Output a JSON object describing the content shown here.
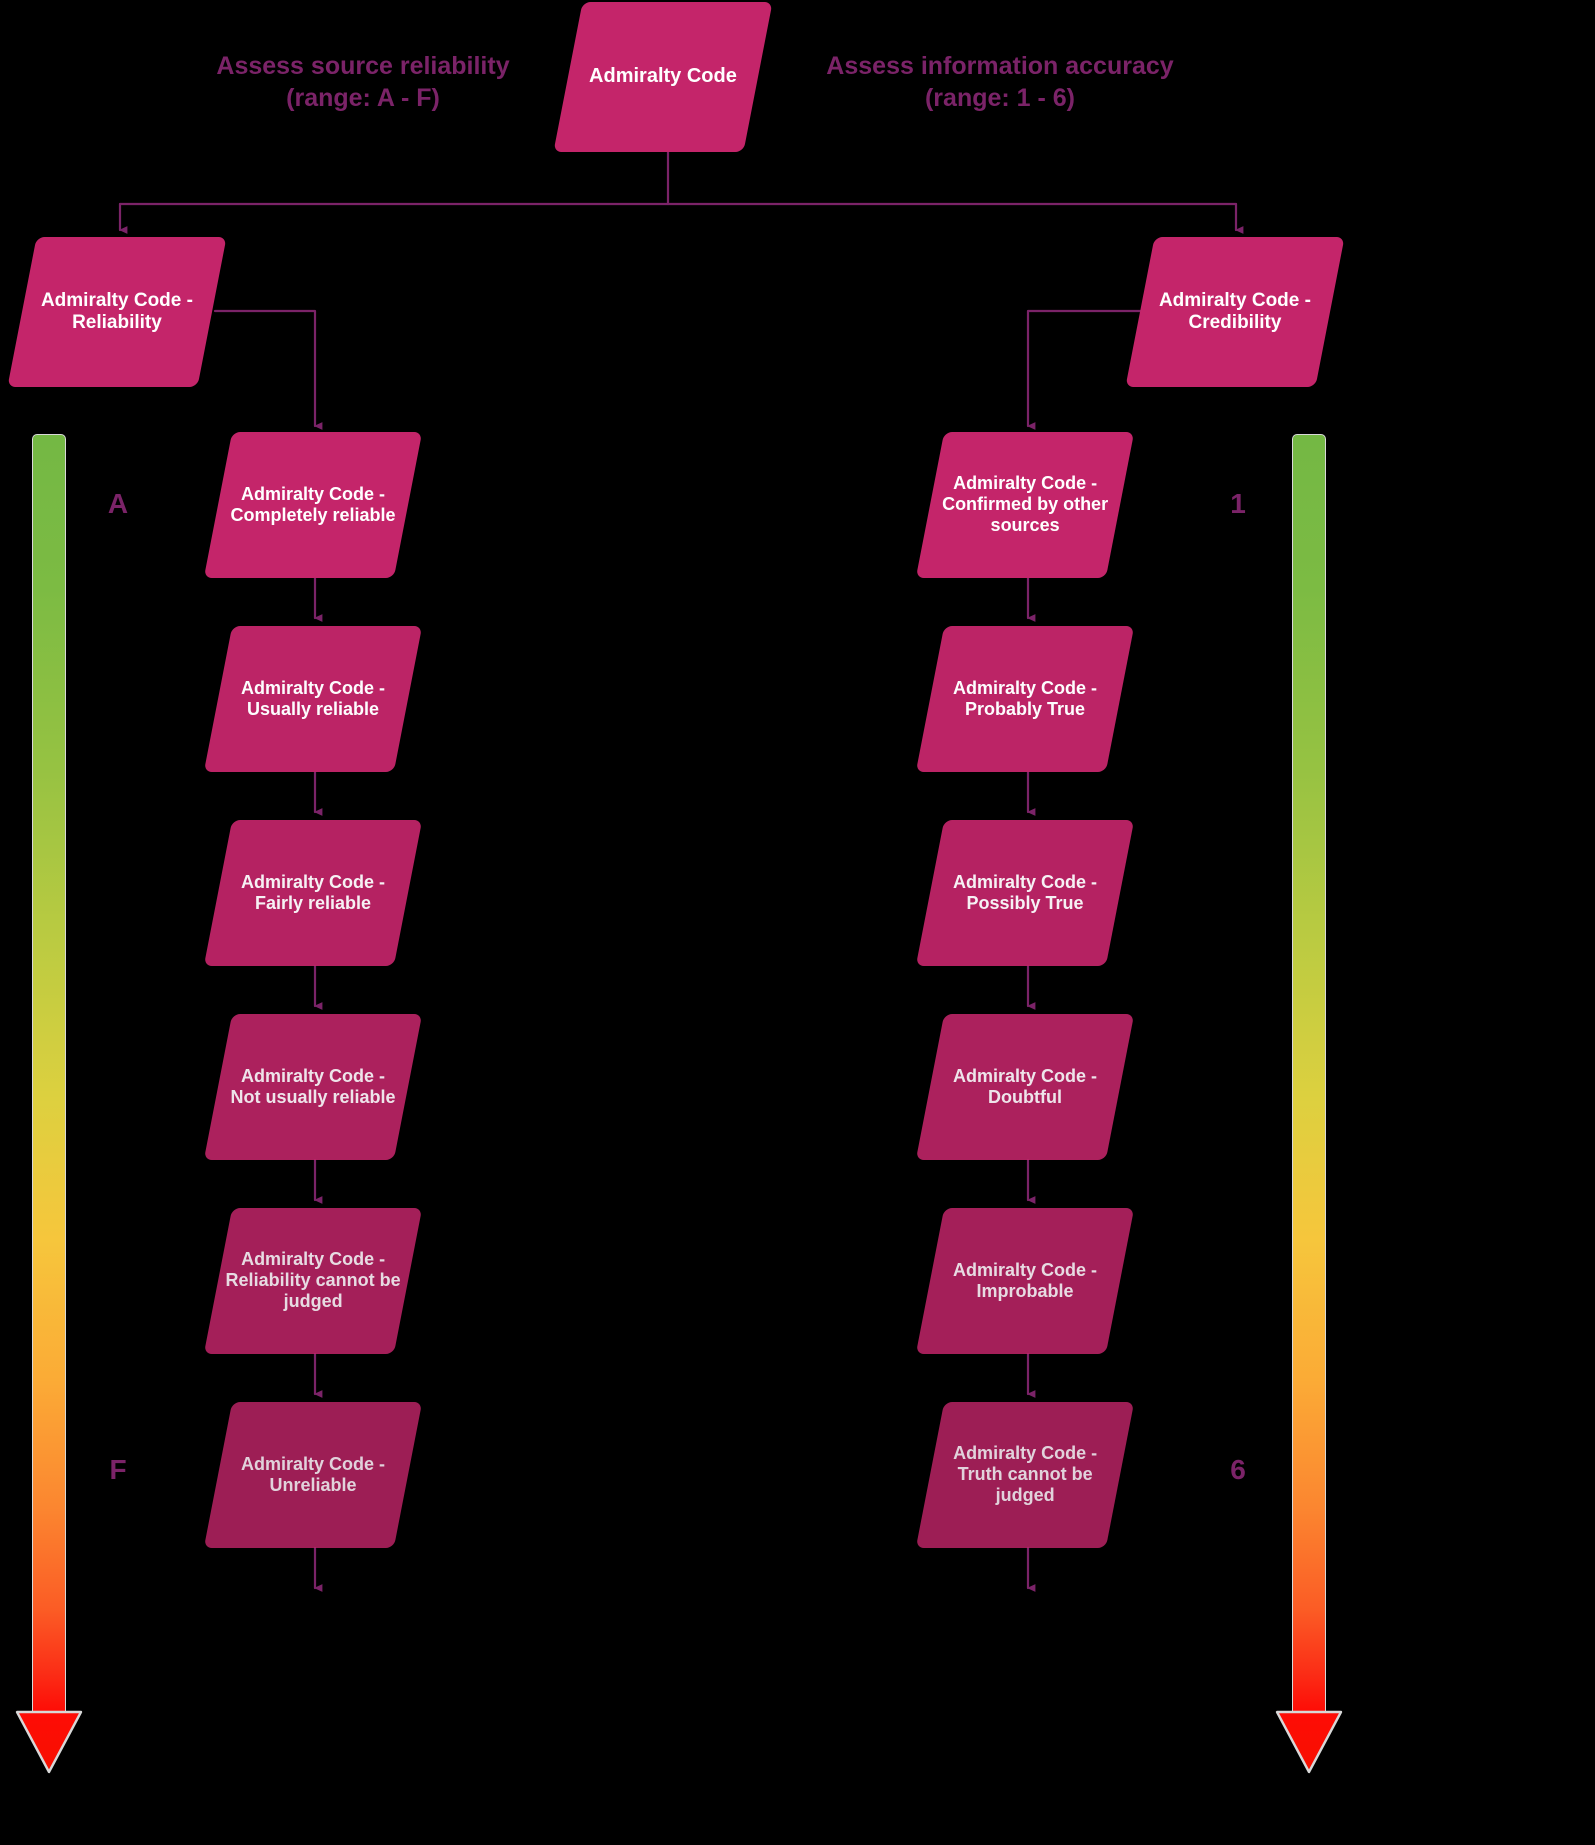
{
  "diagram": {
    "title": "Admiralty Code",
    "background": "#000000",
    "node_color": "#C4256A",
    "edge_color": "#7B2368",
    "caption_color": "#7B2368"
  },
  "root": {
    "label": "Admiralty Code"
  },
  "captions": {
    "left": {
      "line1": "Assess source reliability",
      "line2": "(range: A - F)"
    },
    "right": {
      "line1": "Assess information accuracy",
      "line2": "(range: 1 - 6)"
    }
  },
  "branches": [
    {
      "id": "reliability",
      "label": "Admiralty Code - Reliability"
    },
    {
      "id": "credibility",
      "label": "Admiralty Code - Credibility"
    }
  ],
  "reliability_nodes": [
    {
      "label": "Admiralty Code - Completely reliable"
    },
    {
      "label": "Admiralty Code - Usually reliable"
    },
    {
      "label": "Admiralty Code - Fairly reliable"
    },
    {
      "label": "Admiralty Code - Not usually reliable"
    },
    {
      "label": "Admiralty Code - Reliability cannot be judged"
    },
    {
      "label": "Admiralty Code - Unreliable"
    }
  ],
  "credibility_nodes": [
    {
      "label": "Admiralty Code - Confirmed by other sources"
    },
    {
      "label": "Admiralty Code - Probably True"
    },
    {
      "label": "Admiralty Code - Possibly True"
    },
    {
      "label": "Admiralty Code - Doubtful"
    },
    {
      "label": "Admiralty Code - Improbable"
    },
    {
      "label": "Admiralty Code - Truth cannot be judged"
    }
  ],
  "scales": {
    "left": {
      "top": "A",
      "bottom": "F",
      "gradient_start": "#74b844",
      "gradient_end": "#fe0c06"
    },
    "right": {
      "top": "1",
      "bottom": "6",
      "gradient_start": "#74b844",
      "gradient_end": "#fe0c06"
    }
  }
}
